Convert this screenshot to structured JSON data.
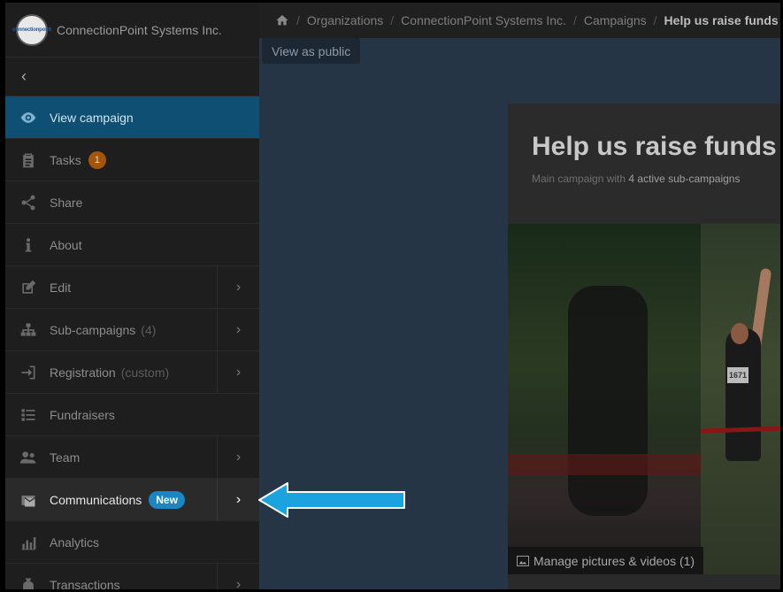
{
  "org": {
    "name": "ConnectionPoint Systems Inc.",
    "logo_text": "connectionpoint"
  },
  "sidebar": {
    "back_glyph": "‹",
    "items": [
      {
        "label": "View campaign",
        "icon": "eye-icon",
        "active": true
      },
      {
        "label": "Tasks",
        "icon": "clipboard-icon",
        "badge": "1"
      },
      {
        "label": "Share",
        "icon": "share-icon"
      },
      {
        "label": "About",
        "icon": "info-icon"
      },
      {
        "label": "Edit",
        "icon": "edit-icon",
        "chevron": true
      },
      {
        "label": "Sub-campaigns",
        "sub": "(4)",
        "icon": "hierarchy-icon",
        "chevron": true
      },
      {
        "label": "Registration",
        "sub": "(custom)",
        "icon": "sign-in-icon",
        "chevron": true
      },
      {
        "label": "Fundraisers",
        "icon": "list-icon"
      },
      {
        "label": "Team",
        "icon": "users-icon",
        "chevron": true
      },
      {
        "label": "Communications",
        "badge_new": "New",
        "icon": "mail-icon",
        "chevron": true
      },
      {
        "label": "Analytics",
        "icon": "chart-icon"
      },
      {
        "label": "Transactions",
        "icon": "money-icon",
        "chevron": true
      }
    ],
    "chevron_glyph": "›"
  },
  "breadcrumb": {
    "items": [
      "Organizations",
      "ConnectionPoint Systems Inc.",
      "Campaigns"
    ],
    "current": "Help us raise funds in",
    "separator": "/"
  },
  "view_public_label": "View as public",
  "campaign": {
    "title": "Help us raise funds",
    "subtitle_prefix": "Main campaign with",
    "subtitle_link": "4 active sub-campaigns",
    "bib_number": "1671",
    "manage_label": "Manage pictures & videos (1)"
  },
  "colors": {
    "accent": "#1a86c2",
    "active_bg": "#0f4f74",
    "badge": "#a3560a"
  }
}
